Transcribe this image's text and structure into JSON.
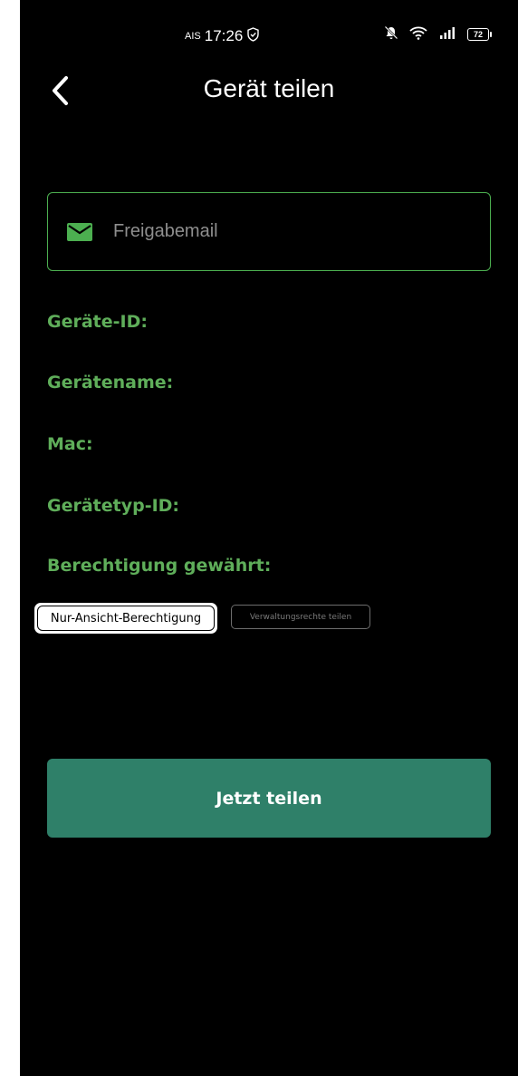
{
  "status_bar": {
    "carrier": "AIS",
    "time": "17:26",
    "battery_level": "72",
    "icons": [
      "shield-check-icon",
      "bell-off-icon",
      "wifi-icon",
      "signal-icon",
      "battery-icon"
    ]
  },
  "header": {
    "title": "Gerät teilen",
    "back_icon": "chevron-left-icon"
  },
  "email_field": {
    "placeholder": "Freigabemail",
    "value": "",
    "icon": "envelope-icon"
  },
  "device_info": {
    "device_id_label": "Geräte-ID:",
    "device_name_label": "Gerätename:",
    "mac_label": "Mac:",
    "device_type_id_label": "Gerätetyp-ID:",
    "permission_label": "Berechtigung gewährt:"
  },
  "permissions": {
    "view_only": "Nur-Ansicht-Berechtigung",
    "admin": "Verwaltungsrechte teilen",
    "selected": "view_only"
  },
  "actions": {
    "share_label": "Jetzt teilen"
  },
  "colors": {
    "background": "#000000",
    "accent_green": "#5fae5a",
    "field_border": "#4caf50",
    "button": "#2f8069"
  }
}
